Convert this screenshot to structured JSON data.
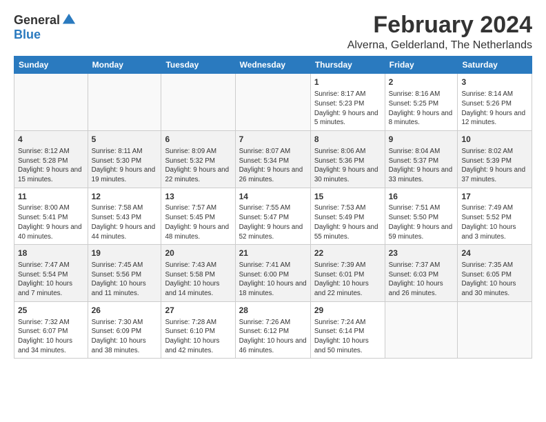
{
  "header": {
    "logo_general": "General",
    "logo_blue": "Blue",
    "month_title": "February 2024",
    "location": "Alverna, Gelderland, The Netherlands"
  },
  "weekdays": [
    "Sunday",
    "Monday",
    "Tuesday",
    "Wednesday",
    "Thursday",
    "Friday",
    "Saturday"
  ],
  "weeks": [
    [
      {
        "day": "",
        "info": ""
      },
      {
        "day": "",
        "info": ""
      },
      {
        "day": "",
        "info": ""
      },
      {
        "day": "",
        "info": ""
      },
      {
        "day": "1",
        "info": "Sunrise: 8:17 AM\nSunset: 5:23 PM\nDaylight: 9 hours\nand 5 minutes."
      },
      {
        "day": "2",
        "info": "Sunrise: 8:16 AM\nSunset: 5:25 PM\nDaylight: 9 hours\nand 8 minutes."
      },
      {
        "day": "3",
        "info": "Sunrise: 8:14 AM\nSunset: 5:26 PM\nDaylight: 9 hours\nand 12 minutes."
      }
    ],
    [
      {
        "day": "4",
        "info": "Sunrise: 8:12 AM\nSunset: 5:28 PM\nDaylight: 9 hours\nand 15 minutes."
      },
      {
        "day": "5",
        "info": "Sunrise: 8:11 AM\nSunset: 5:30 PM\nDaylight: 9 hours\nand 19 minutes."
      },
      {
        "day": "6",
        "info": "Sunrise: 8:09 AM\nSunset: 5:32 PM\nDaylight: 9 hours\nand 22 minutes."
      },
      {
        "day": "7",
        "info": "Sunrise: 8:07 AM\nSunset: 5:34 PM\nDaylight: 9 hours\nand 26 minutes."
      },
      {
        "day": "8",
        "info": "Sunrise: 8:06 AM\nSunset: 5:36 PM\nDaylight: 9 hours\nand 30 minutes."
      },
      {
        "day": "9",
        "info": "Sunrise: 8:04 AM\nSunset: 5:37 PM\nDaylight: 9 hours\nand 33 minutes."
      },
      {
        "day": "10",
        "info": "Sunrise: 8:02 AM\nSunset: 5:39 PM\nDaylight: 9 hours\nand 37 minutes."
      }
    ],
    [
      {
        "day": "11",
        "info": "Sunrise: 8:00 AM\nSunset: 5:41 PM\nDaylight: 9 hours\nand 40 minutes."
      },
      {
        "day": "12",
        "info": "Sunrise: 7:58 AM\nSunset: 5:43 PM\nDaylight: 9 hours\nand 44 minutes."
      },
      {
        "day": "13",
        "info": "Sunrise: 7:57 AM\nSunset: 5:45 PM\nDaylight: 9 hours\nand 48 minutes."
      },
      {
        "day": "14",
        "info": "Sunrise: 7:55 AM\nSunset: 5:47 PM\nDaylight: 9 hours\nand 52 minutes."
      },
      {
        "day": "15",
        "info": "Sunrise: 7:53 AM\nSunset: 5:49 PM\nDaylight: 9 hours\nand 55 minutes."
      },
      {
        "day": "16",
        "info": "Sunrise: 7:51 AM\nSunset: 5:50 PM\nDaylight: 9 hours\nand 59 minutes."
      },
      {
        "day": "17",
        "info": "Sunrise: 7:49 AM\nSunset: 5:52 PM\nDaylight: 10 hours\nand 3 minutes."
      }
    ],
    [
      {
        "day": "18",
        "info": "Sunrise: 7:47 AM\nSunset: 5:54 PM\nDaylight: 10 hours\nand 7 minutes."
      },
      {
        "day": "19",
        "info": "Sunrise: 7:45 AM\nSunset: 5:56 PM\nDaylight: 10 hours\nand 11 minutes."
      },
      {
        "day": "20",
        "info": "Sunrise: 7:43 AM\nSunset: 5:58 PM\nDaylight: 10 hours\nand 14 minutes."
      },
      {
        "day": "21",
        "info": "Sunrise: 7:41 AM\nSunset: 6:00 PM\nDaylight: 10 hours\nand 18 minutes."
      },
      {
        "day": "22",
        "info": "Sunrise: 7:39 AM\nSunset: 6:01 PM\nDaylight: 10 hours\nand 22 minutes."
      },
      {
        "day": "23",
        "info": "Sunrise: 7:37 AM\nSunset: 6:03 PM\nDaylight: 10 hours\nand 26 minutes."
      },
      {
        "day": "24",
        "info": "Sunrise: 7:35 AM\nSunset: 6:05 PM\nDaylight: 10 hours\nand 30 minutes."
      }
    ],
    [
      {
        "day": "25",
        "info": "Sunrise: 7:32 AM\nSunset: 6:07 PM\nDaylight: 10 hours\nand 34 minutes."
      },
      {
        "day": "26",
        "info": "Sunrise: 7:30 AM\nSunset: 6:09 PM\nDaylight: 10 hours\nand 38 minutes."
      },
      {
        "day": "27",
        "info": "Sunrise: 7:28 AM\nSunset: 6:10 PM\nDaylight: 10 hours\nand 42 minutes."
      },
      {
        "day": "28",
        "info": "Sunrise: 7:26 AM\nSunset: 6:12 PM\nDaylight: 10 hours\nand 46 minutes."
      },
      {
        "day": "29",
        "info": "Sunrise: 7:24 AM\nSunset: 6:14 PM\nDaylight: 10 hours\nand 50 minutes."
      },
      {
        "day": "",
        "info": ""
      },
      {
        "day": "",
        "info": ""
      }
    ]
  ]
}
